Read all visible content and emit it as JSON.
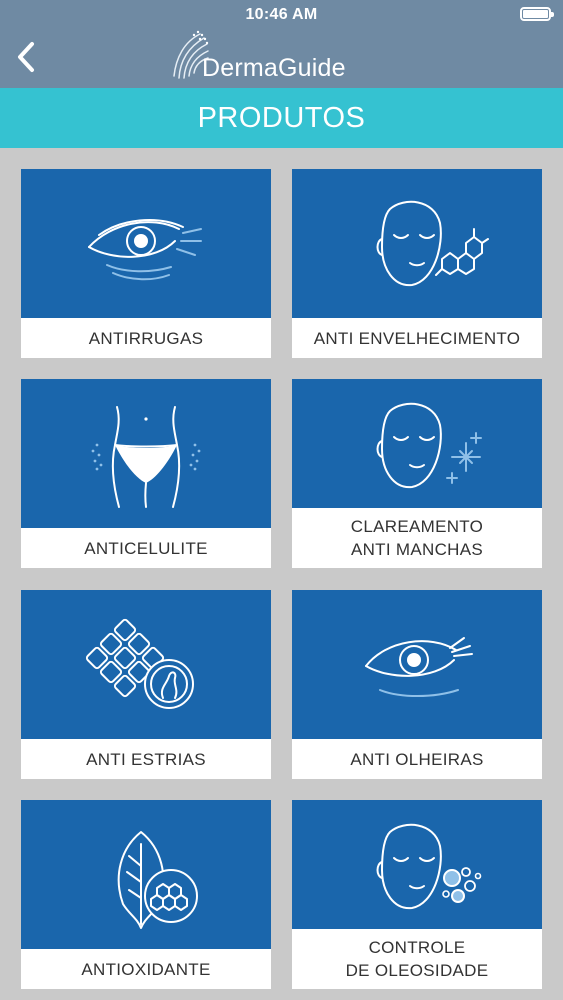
{
  "status_bar": {
    "time": "10:46 AM"
  },
  "header": {
    "logo_text": "DermaGuide",
    "back_icon": "chevron-left-icon"
  },
  "title": "PRODUTOS",
  "products": [
    {
      "label": "ANTIRRUGAS",
      "icon": "eye-wrinkles-icon"
    },
    {
      "label": "ANTI ENVELHECIMENTO",
      "icon": "face-molecule-icon"
    },
    {
      "label": "ANTICELULITE",
      "icon": "hips-icon"
    },
    {
      "label": "CLAREAMENTO\nANTI MANCHAS",
      "icon": "face-sparkle-icon"
    },
    {
      "label": "ANTI ESTRIAS",
      "icon": "skin-cells-icon"
    },
    {
      "label": "ANTI OLHEIRAS",
      "icon": "eye-circles-icon"
    },
    {
      "label": "ANTIOXIDANTE",
      "icon": "leaf-honeycomb-icon"
    },
    {
      "label": "CONTROLE\nDE OLEOSIDADE",
      "icon": "face-bubbles-icon"
    }
  ],
  "colors": {
    "header": "#6f8aa3",
    "title_bar": "#35c2d1",
    "tile": "#1a66ac",
    "background": "#c9c9c9"
  }
}
